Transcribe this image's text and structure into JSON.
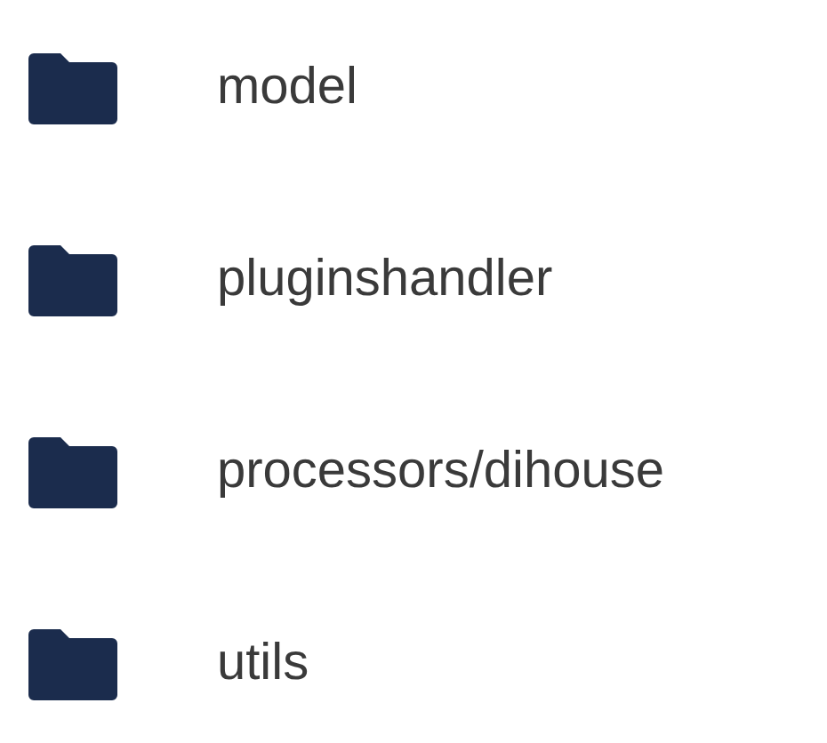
{
  "folders": [
    {
      "name": "model"
    },
    {
      "name": "pluginshandler"
    },
    {
      "name": "processors/dihouse"
    },
    {
      "name": "utils"
    }
  ]
}
